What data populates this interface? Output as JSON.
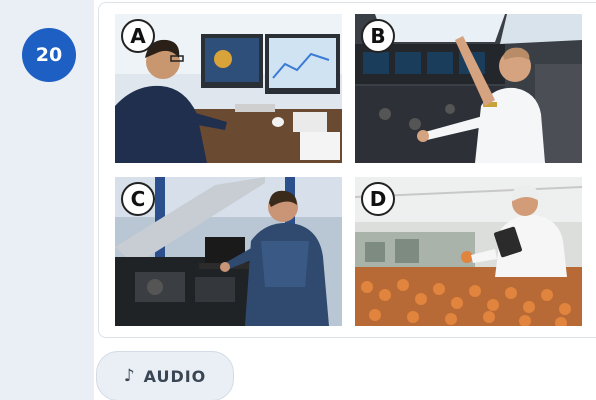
{
  "question": {
    "number": "20"
  },
  "options": [
    {
      "letter": "A",
      "description": "photo-man-at-computer-monitors"
    },
    {
      "letter": "B",
      "description": "photo-pilot-in-cockpit"
    },
    {
      "letter": "C",
      "description": "photo-mechanic-laptop-engine"
    },
    {
      "letter": "D",
      "description": "photo-worker-tablet-fruit-line"
    }
  ],
  "audio": {
    "icon": "music-note-icon",
    "icon_glyph": "♪",
    "label": "AUDIO"
  },
  "colors": {
    "badge": "#1d5fc2",
    "strip": "#e9eff5",
    "button": "#e9eff5"
  }
}
